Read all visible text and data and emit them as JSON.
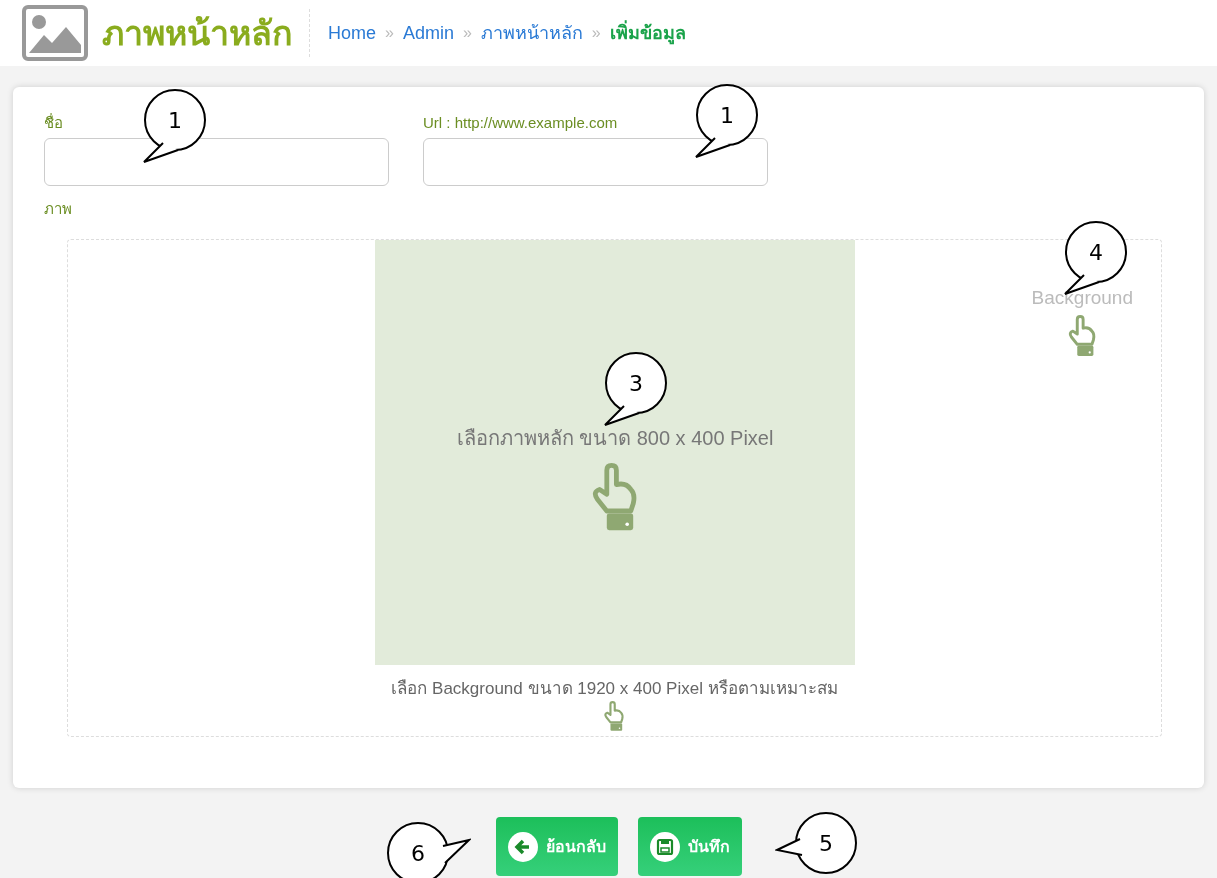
{
  "header": {
    "title": "ภาพหน้าหลัก",
    "separator": "»",
    "breadcrumb": [
      {
        "label": "Home",
        "current": false
      },
      {
        "label": "Admin",
        "current": false
      },
      {
        "label": "ภาพหน้าหลัก",
        "current": false
      },
      {
        "label": "เพิ่มข้อมูล",
        "current": true
      }
    ]
  },
  "form": {
    "fields": [
      {
        "label": "ชื่อ"
      },
      {
        "label": "Url : http://www.example.com"
      }
    ],
    "image_label": "ภาพ",
    "image_area": {
      "main_prompt": "เลือกภาพหลัก ขนาด 800 x 400 Pixel",
      "background_prompt": "เลือก Background ขนาด 1920 x 400 Pixel หรือตามเหมาะสม",
      "background_label": "Background"
    }
  },
  "buttons": [
    {
      "kind": "back",
      "label": "ย้อนกลับ"
    },
    {
      "kind": "save",
      "label": "บันทึก"
    }
  ],
  "callouts": [
    {
      "label": "1"
    },
    {
      "label": "1"
    },
    {
      "label": "3"
    },
    {
      "label": "4"
    },
    {
      "label": "5"
    },
    {
      "label": "6"
    }
  ]
}
